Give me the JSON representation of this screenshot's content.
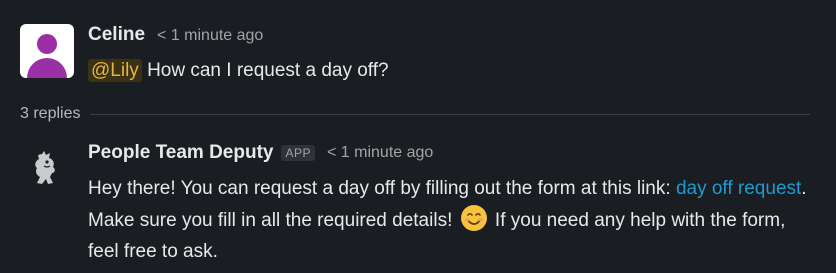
{
  "parent_message": {
    "sender": "Celine",
    "timestamp": "< 1 minute ago",
    "mention": "@Lily",
    "text": " How can I request a day off?"
  },
  "thread": {
    "replies_label": "3 replies"
  },
  "reply": {
    "sender": "People Team Deputy",
    "badge": "APP",
    "timestamp": "< 1 minute ago",
    "text_part1": "Hey there! You can request a day off by filling out the form at this link: ",
    "link_text": "day off request",
    "text_part2": ". Make sure you fill in all the required details! ",
    "emoji": "smiling-face-emoji",
    "text_part3": " If you need any help with the form, feel free to ask."
  },
  "colors": {
    "background": "#1a1d21",
    "mention_text": "#e7b443",
    "link": "#1d9bd1",
    "avatar_purple": "#9b2fa5"
  }
}
